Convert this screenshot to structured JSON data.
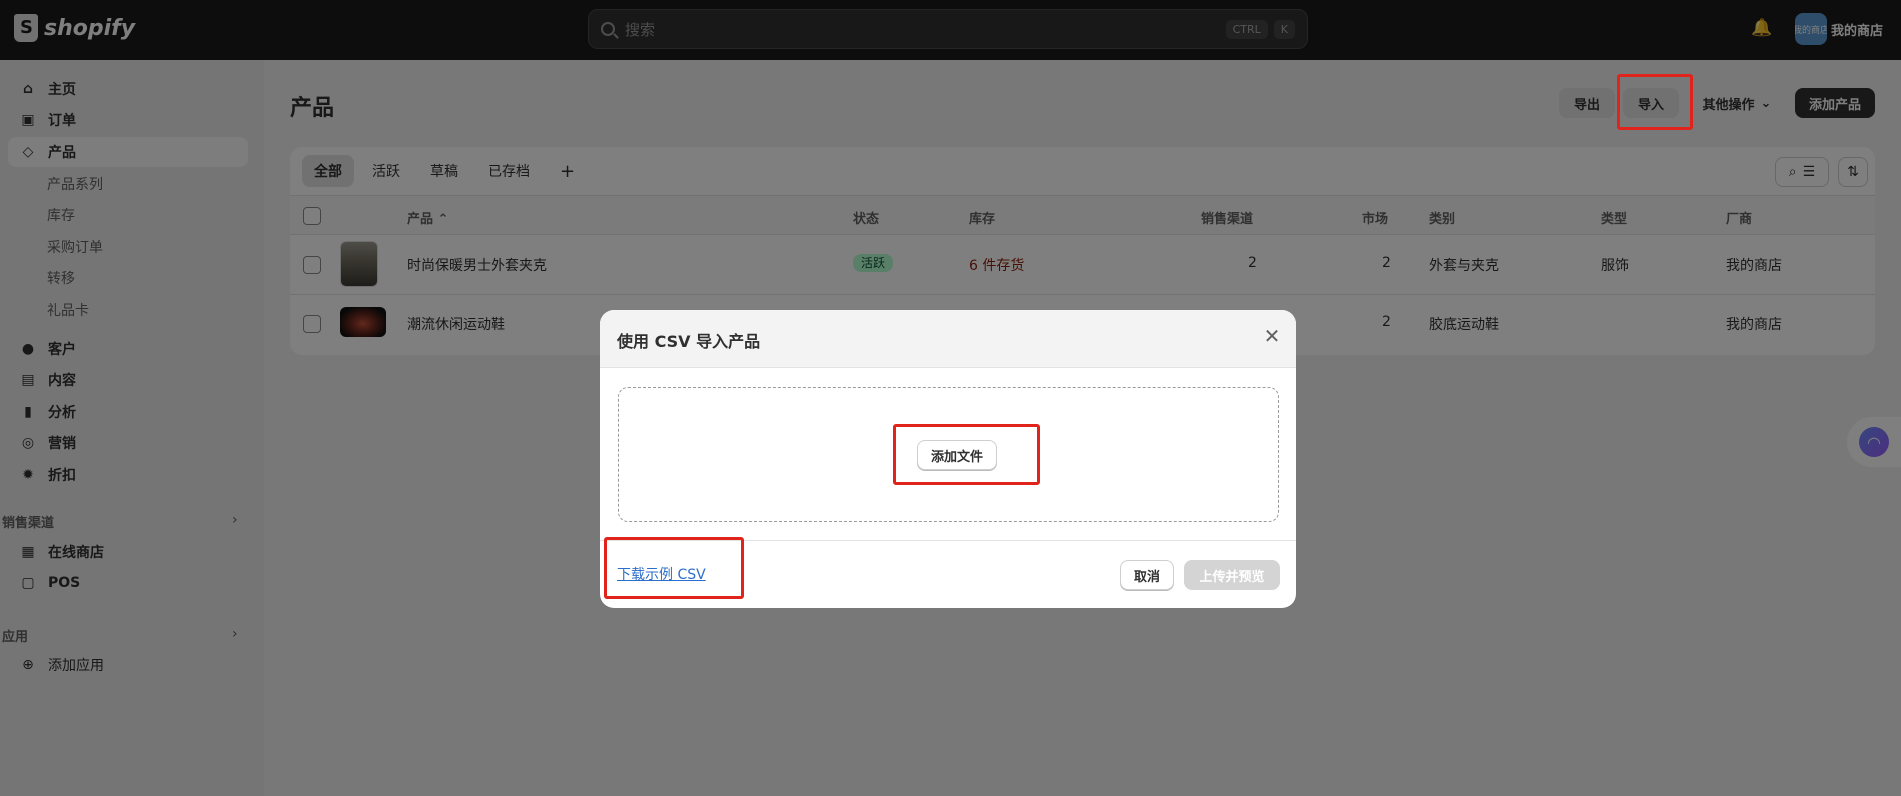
{
  "topbar": {
    "logo": "shopify",
    "search_placeholder": "搜索",
    "kbd1": "CTRL",
    "kbd2": "K",
    "avatar_text": "我的商店",
    "shop_name": "我的商店"
  },
  "sidebar": {
    "home": "主页",
    "orders": "订单",
    "products": "产品",
    "sub": [
      "产品系列",
      "库存",
      "采购订单",
      "转移",
      "礼品卡"
    ],
    "customers": "客户",
    "content": "内容",
    "analytics": "分析",
    "marketing": "营销",
    "discounts": "折扣",
    "sales_channels_title": "销售渠道",
    "online_store": "在线商店",
    "pos": "POS",
    "apps_title": "应用",
    "add_app": "添加应用"
  },
  "page": {
    "title": "产品",
    "export": "导出",
    "import": "导入",
    "more": "其他操作",
    "add_product": "添加产品"
  },
  "tabs": [
    "全部",
    "活跃",
    "草稿",
    "已存档"
  ],
  "table": {
    "headers": {
      "product": "产品",
      "status": "状态",
      "inventory": "库存",
      "channels": "销售渠道",
      "markets": "市场",
      "category": "类别",
      "type": "类型",
      "vendor": "厂商"
    },
    "rows": [
      {
        "name": "时尚保暖男士外套夹克",
        "status": "活跃",
        "inventory": "6 件存货",
        "channels": "2",
        "markets": "2",
        "category": "外套与夹克",
        "type": "服饰",
        "vendor": "我的商店"
      },
      {
        "name": "潮流休闲运动鞋",
        "markets": "2",
        "category": "胶底运动鞋",
        "vendor": "我的商店"
      }
    ]
  },
  "modal": {
    "title": "使用 CSV 导入产品",
    "add_file": "添加文件",
    "download_link": "下载示例 CSV",
    "cancel": "取消",
    "upload": "上传并预览"
  },
  "colors": {
    "topbar_bg": "#1a1a1a",
    "highlight": "#e0241b",
    "link": "#2c6ecb",
    "status_active_bg": "#b4fed2"
  }
}
